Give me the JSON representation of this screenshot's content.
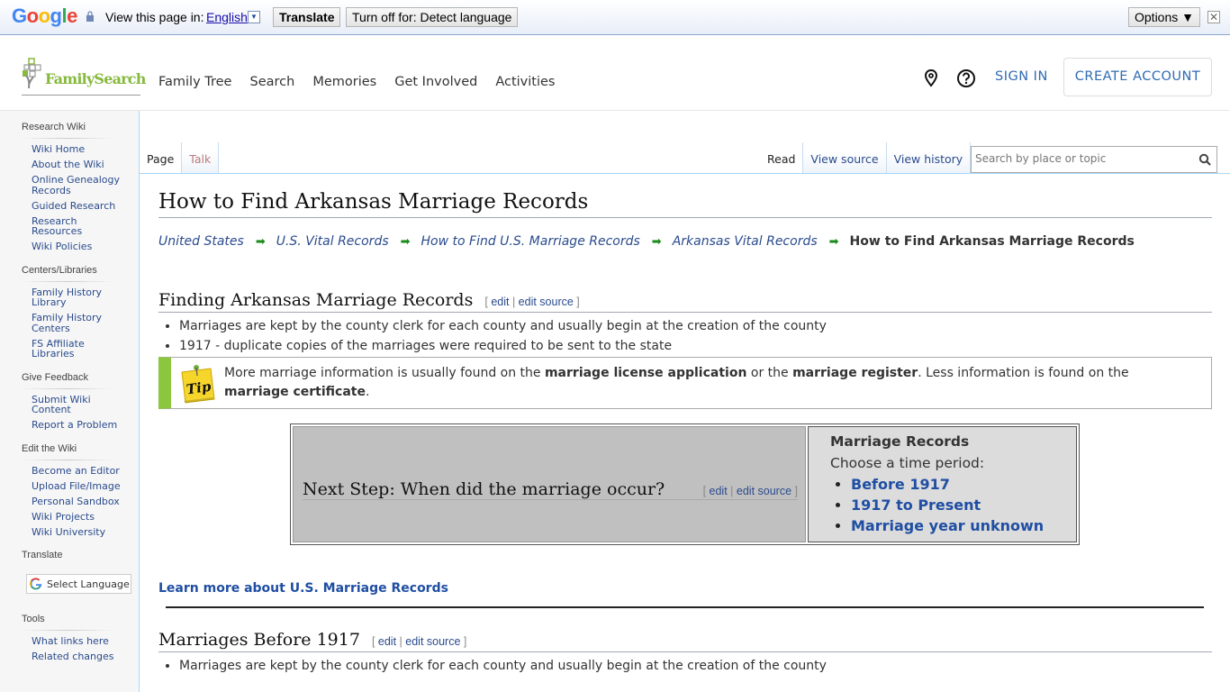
{
  "translate_bar": {
    "brand": [
      "G",
      "o",
      "o",
      "g",
      "l",
      "e"
    ],
    "view_label": "View this page in:",
    "language": "English",
    "translate_button": "Translate",
    "turn_off_button": "Turn off for: Detect language",
    "options_button": "Options ▼",
    "close_glyph": "✕"
  },
  "header": {
    "logo_text": "FamilySearch",
    "nav": [
      "Family Tree",
      "Search",
      "Memories",
      "Get Involved",
      "Activities"
    ],
    "sign_in": "SIGN IN",
    "create_account": "CREATE ACCOUNT"
  },
  "sidebar": {
    "sections": [
      {
        "heading": "Research Wiki",
        "items": [
          "Wiki Home",
          "About the Wiki",
          "Online Genealogy Records",
          "Guided Research",
          "Research Resources",
          "Wiki Policies"
        ]
      },
      {
        "heading": "Centers/Libraries",
        "items": [
          "Family History Library",
          "Family History Centers",
          "FS Affiliate Libraries"
        ]
      },
      {
        "heading": "Give Feedback",
        "items": [
          "Submit Wiki Content",
          "Report a Problem"
        ]
      },
      {
        "heading": "Edit the Wiki",
        "items": [
          "Become an Editor",
          "Upload File/Image",
          "Personal Sandbox",
          "Wiki Projects",
          "Wiki University"
        ]
      },
      {
        "heading": "Translate",
        "select_language": "Select Language"
      },
      {
        "heading": "Tools",
        "items": [
          "What links here",
          "Related changes"
        ]
      }
    ]
  },
  "tabs": {
    "left": [
      "Page",
      "Talk"
    ],
    "right": [
      "Read",
      "View source",
      "View history"
    ],
    "search_placeholder": "Search by place or topic"
  },
  "page": {
    "title": "How to Find Arkansas Marriage Records",
    "breadcrumb": [
      "United States",
      "U.S. Vital Records",
      "How to Find U.S. Marriage Records",
      "Arkansas Vital Records"
    ],
    "breadcrumb_current": "How to Find Arkansas Marriage Records",
    "edit_label": "edit",
    "edit_source_label": "edit source",
    "section1": {
      "heading": "Finding Arkansas Marriage Records",
      "bullets": [
        "Marriages are kept by the county clerk for each county and usually begin at the creation of the county",
        "1917 - duplicate copies of the marriages were required to be sent to the state"
      ]
    },
    "tip": {
      "icon_label": "Tip",
      "t1": "More marriage information is usually found on the ",
      "b1": "marriage license application",
      "t2": " or the ",
      "b2": "marriage register",
      "t3": ". Less information is found on the ",
      "b3": "marriage certificate",
      "t4": "."
    },
    "next_step": {
      "heading": "Next Step: When did the marriage occur?",
      "box_title": "Marriage Records",
      "box_subtitle": "Choose a time period:",
      "options": [
        "Before 1917",
        "1917 to Present",
        "Marriage year unknown"
      ]
    },
    "learn_more": "Learn more about U.S. Marriage Records",
    "section2": {
      "heading": "Marriages Before 1917",
      "bullets": [
        "Marriages are kept by the county clerk for each county and usually begin at the creation of the county"
      ]
    }
  }
}
